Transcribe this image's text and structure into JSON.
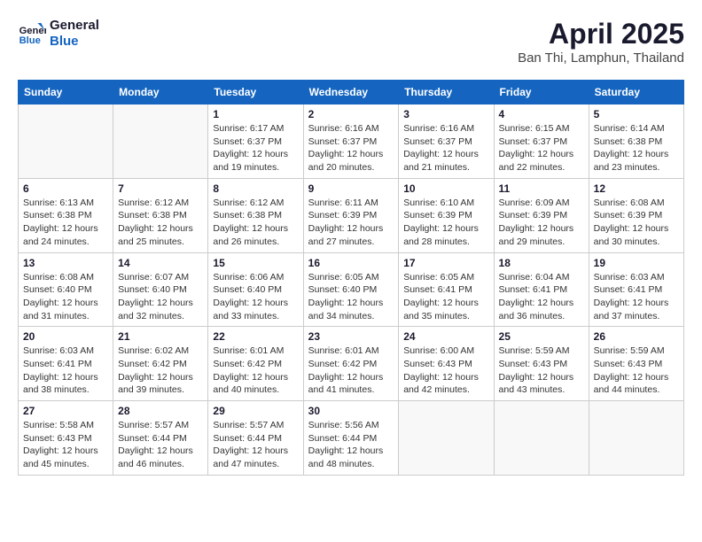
{
  "logo": {
    "line1": "General",
    "line2": "Blue"
  },
  "title": "April 2025",
  "location": "Ban Thi, Lamphun, Thailand",
  "days_of_week": [
    "Sunday",
    "Monday",
    "Tuesday",
    "Wednesday",
    "Thursday",
    "Friday",
    "Saturday"
  ],
  "weeks": [
    [
      {
        "day": "",
        "info": ""
      },
      {
        "day": "",
        "info": ""
      },
      {
        "day": "1",
        "info": "Sunrise: 6:17 AM\nSunset: 6:37 PM\nDaylight: 12 hours and 19 minutes."
      },
      {
        "day": "2",
        "info": "Sunrise: 6:16 AM\nSunset: 6:37 PM\nDaylight: 12 hours and 20 minutes."
      },
      {
        "day": "3",
        "info": "Sunrise: 6:16 AM\nSunset: 6:37 PM\nDaylight: 12 hours and 21 minutes."
      },
      {
        "day": "4",
        "info": "Sunrise: 6:15 AM\nSunset: 6:37 PM\nDaylight: 12 hours and 22 minutes."
      },
      {
        "day": "5",
        "info": "Sunrise: 6:14 AM\nSunset: 6:38 PM\nDaylight: 12 hours and 23 minutes."
      }
    ],
    [
      {
        "day": "6",
        "info": "Sunrise: 6:13 AM\nSunset: 6:38 PM\nDaylight: 12 hours and 24 minutes."
      },
      {
        "day": "7",
        "info": "Sunrise: 6:12 AM\nSunset: 6:38 PM\nDaylight: 12 hours and 25 minutes."
      },
      {
        "day": "8",
        "info": "Sunrise: 6:12 AM\nSunset: 6:38 PM\nDaylight: 12 hours and 26 minutes."
      },
      {
        "day": "9",
        "info": "Sunrise: 6:11 AM\nSunset: 6:39 PM\nDaylight: 12 hours and 27 minutes."
      },
      {
        "day": "10",
        "info": "Sunrise: 6:10 AM\nSunset: 6:39 PM\nDaylight: 12 hours and 28 minutes."
      },
      {
        "day": "11",
        "info": "Sunrise: 6:09 AM\nSunset: 6:39 PM\nDaylight: 12 hours and 29 minutes."
      },
      {
        "day": "12",
        "info": "Sunrise: 6:08 AM\nSunset: 6:39 PM\nDaylight: 12 hours and 30 minutes."
      }
    ],
    [
      {
        "day": "13",
        "info": "Sunrise: 6:08 AM\nSunset: 6:40 PM\nDaylight: 12 hours and 31 minutes."
      },
      {
        "day": "14",
        "info": "Sunrise: 6:07 AM\nSunset: 6:40 PM\nDaylight: 12 hours and 32 minutes."
      },
      {
        "day": "15",
        "info": "Sunrise: 6:06 AM\nSunset: 6:40 PM\nDaylight: 12 hours and 33 minutes."
      },
      {
        "day": "16",
        "info": "Sunrise: 6:05 AM\nSunset: 6:40 PM\nDaylight: 12 hours and 34 minutes."
      },
      {
        "day": "17",
        "info": "Sunrise: 6:05 AM\nSunset: 6:41 PM\nDaylight: 12 hours and 35 minutes."
      },
      {
        "day": "18",
        "info": "Sunrise: 6:04 AM\nSunset: 6:41 PM\nDaylight: 12 hours and 36 minutes."
      },
      {
        "day": "19",
        "info": "Sunrise: 6:03 AM\nSunset: 6:41 PM\nDaylight: 12 hours and 37 minutes."
      }
    ],
    [
      {
        "day": "20",
        "info": "Sunrise: 6:03 AM\nSunset: 6:41 PM\nDaylight: 12 hours and 38 minutes."
      },
      {
        "day": "21",
        "info": "Sunrise: 6:02 AM\nSunset: 6:42 PM\nDaylight: 12 hours and 39 minutes."
      },
      {
        "day": "22",
        "info": "Sunrise: 6:01 AM\nSunset: 6:42 PM\nDaylight: 12 hours and 40 minutes."
      },
      {
        "day": "23",
        "info": "Sunrise: 6:01 AM\nSunset: 6:42 PM\nDaylight: 12 hours and 41 minutes."
      },
      {
        "day": "24",
        "info": "Sunrise: 6:00 AM\nSunset: 6:43 PM\nDaylight: 12 hours and 42 minutes."
      },
      {
        "day": "25",
        "info": "Sunrise: 5:59 AM\nSunset: 6:43 PM\nDaylight: 12 hours and 43 minutes."
      },
      {
        "day": "26",
        "info": "Sunrise: 5:59 AM\nSunset: 6:43 PM\nDaylight: 12 hours and 44 minutes."
      }
    ],
    [
      {
        "day": "27",
        "info": "Sunrise: 5:58 AM\nSunset: 6:43 PM\nDaylight: 12 hours and 45 minutes."
      },
      {
        "day": "28",
        "info": "Sunrise: 5:57 AM\nSunset: 6:44 PM\nDaylight: 12 hours and 46 minutes."
      },
      {
        "day": "29",
        "info": "Sunrise: 5:57 AM\nSunset: 6:44 PM\nDaylight: 12 hours and 47 minutes."
      },
      {
        "day": "30",
        "info": "Sunrise: 5:56 AM\nSunset: 6:44 PM\nDaylight: 12 hours and 48 minutes."
      },
      {
        "day": "",
        "info": ""
      },
      {
        "day": "",
        "info": ""
      },
      {
        "day": "",
        "info": ""
      }
    ]
  ]
}
